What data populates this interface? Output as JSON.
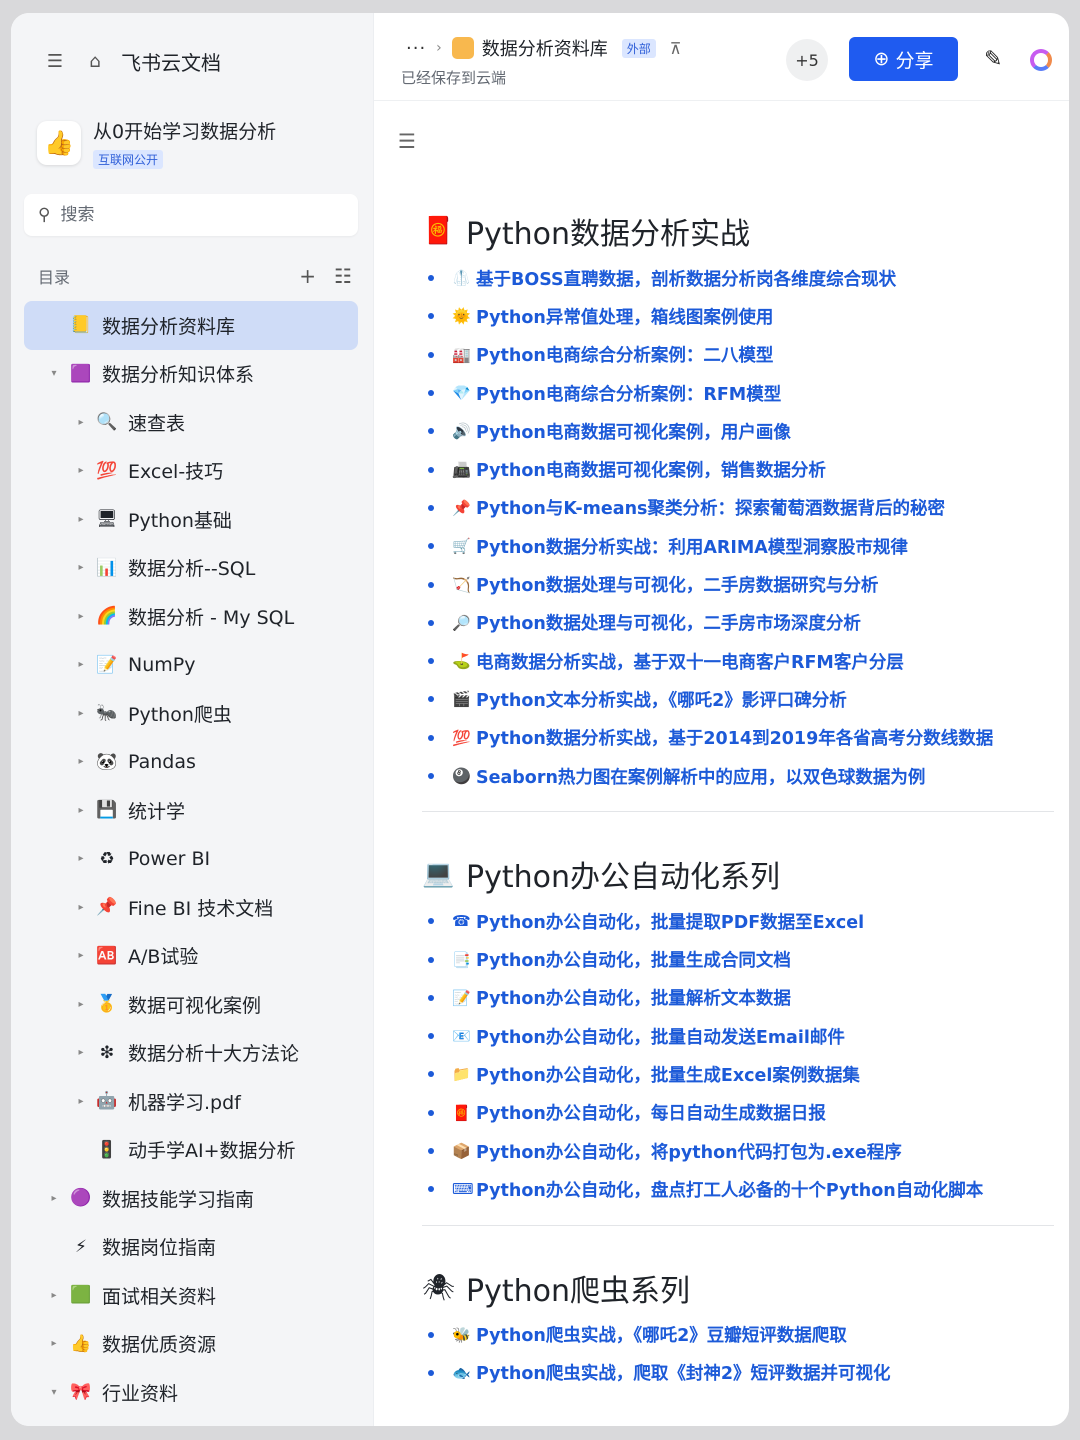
{
  "sidebar": {
    "brand": "飞书云文档",
    "workspace": {
      "title": "从0开始学习数据分析",
      "badge": "互联网公开",
      "avatar_icon": "thumbs-up-icon"
    },
    "search_placeholder": "搜索",
    "toc_label": "目录",
    "items": [
      {
        "label": "数据分析资料库",
        "level": 0,
        "arrow": "",
        "icon": "📒",
        "active": true
      },
      {
        "label": "数据分析知识体系",
        "level": 0,
        "arrow": "▾",
        "icon": "🟪"
      },
      {
        "label": "速查表",
        "level": 1,
        "arrow": "▸",
        "icon": "🔍"
      },
      {
        "label": "Excel-技巧",
        "level": 1,
        "arrow": "▸",
        "icon": "💯"
      },
      {
        "label": "Python基础",
        "level": 1,
        "arrow": "▸",
        "icon": "🖥"
      },
      {
        "label": "数据分析--SQL",
        "level": 1,
        "arrow": "▸",
        "icon": "📊"
      },
      {
        "label": "数据分析 - My SQL",
        "level": 1,
        "arrow": "▸",
        "icon": "🌈"
      },
      {
        "label": "NumPy",
        "level": 1,
        "arrow": "▸",
        "icon": "📝"
      },
      {
        "label": "Python爬虫",
        "level": 1,
        "arrow": "▸",
        "icon": "🐜"
      },
      {
        "label": "Pandas",
        "level": 1,
        "arrow": "▸",
        "icon": "🐼"
      },
      {
        "label": "统计学",
        "level": 1,
        "arrow": "▸",
        "icon": "💾"
      },
      {
        "label": "Power BI",
        "level": 1,
        "arrow": "▸",
        "icon": "♻"
      },
      {
        "label": "Fine BI 技术文档",
        "level": 1,
        "arrow": "▸",
        "icon": "📌"
      },
      {
        "label": "A/B试验",
        "level": 1,
        "arrow": "▸",
        "icon": "🆎"
      },
      {
        "label": "数据可视化案例",
        "level": 1,
        "arrow": "▸",
        "icon": "🥇"
      },
      {
        "label": "数据分析十大方法论",
        "level": 1,
        "arrow": "▸",
        "icon": "❇"
      },
      {
        "label": "机器学习.pdf",
        "level": 1,
        "arrow": "▸",
        "icon": "🤖"
      },
      {
        "label": "动手学AI+数据分析",
        "level": 1,
        "arrow": "",
        "icon": "🚦"
      },
      {
        "label": "数据技能学习指南",
        "level": 0,
        "arrow": "▸",
        "icon": "🟣"
      },
      {
        "label": "数据岗位指南",
        "level": 0,
        "arrow": "",
        "icon": "⚡"
      },
      {
        "label": "面试相关资料",
        "level": 0,
        "arrow": "▸",
        "icon": "🟩"
      },
      {
        "label": "数据优质资源",
        "level": 0,
        "arrow": "▸",
        "icon": "👍"
      },
      {
        "label": "行业资料",
        "level": 0,
        "arrow": "▾",
        "icon": "🎀"
      }
    ]
  },
  "header": {
    "breadcrumb_dots": "···",
    "doc_title": "数据分析资料库",
    "external_badge": "外部",
    "saved_status": "已经保存到云端",
    "collaborators": "+5",
    "share_label": "分享"
  },
  "sections": [
    {
      "title": "Python数据分析实战",
      "emoji": "🧧",
      "items": [
        {
          "emoji": "🥼",
          "text": "基于BOSS直聘数据，剖析数据分析岗各维度综合现状"
        },
        {
          "emoji": "🌞",
          "text": "Python异常值处理，箱线图案例使用"
        },
        {
          "emoji": "🏭",
          "text": "Python电商综合分析案例：二八模型"
        },
        {
          "emoji": "💎",
          "text": "Python电商综合分析案例：RFM模型"
        },
        {
          "emoji": "🔊",
          "text": "Python电商数据可视化案例，用户画像"
        },
        {
          "emoji": "📠",
          "text": "Python电商数据可视化案例，销售数据分析"
        },
        {
          "emoji": "📌",
          "text": "Python与K-means聚类分析：探索葡萄酒数据背后的秘密"
        },
        {
          "emoji": "🛒",
          "text": "Python数据分析实战：利用ARIMA模型洞察股市规律"
        },
        {
          "emoji": "🏹",
          "text": "Python数据处理与可视化，二手房数据研究与分析"
        },
        {
          "emoji": "🔎",
          "text": "Python数据处理与可视化，二手房市场深度分析"
        },
        {
          "emoji": "⛳",
          "text": "电商数据分析实战，基于双十一电商客户RFM客户分层"
        },
        {
          "emoji": "🎬",
          "text": "Python文本分析实战，《哪吒2》影评口碑分析"
        },
        {
          "emoji": "💯",
          "text": "Python数据分析实战，基于2014到2019年各省高考分数线数据"
        },
        {
          "emoji": "🎱",
          "text": "Seaborn热力图在案例解析中的应用，以双色球数据为例"
        }
      ]
    },
    {
      "title": "Python办公自动化系列",
      "emoji": "💻",
      "items": [
        {
          "emoji": "☎",
          "text": "Python办公自动化，批量提取PDF数据至Excel"
        },
        {
          "emoji": "📑",
          "text": "Python办公自动化，批量生成合同文档"
        },
        {
          "emoji": "📝",
          "text": "Python办公自动化，批量解析文本数据"
        },
        {
          "emoji": "📧",
          "text": "Python办公自动化，批量自动发送Email邮件"
        },
        {
          "emoji": "📁",
          "text": "Python办公自动化，批量生成Excel案例数据集"
        },
        {
          "emoji": "🧧",
          "text": "Python办公自动化，每日自动生成数据日报"
        },
        {
          "emoji": "📦",
          "text": "Python办公自动化，将python代码打包为.exe程序"
        },
        {
          "emoji": "⌨",
          "text": "Python办公自动化，盘点打工人必备的十个Python自动化脚本"
        }
      ]
    },
    {
      "title": "Python爬虫系列",
      "emoji": "🕷",
      "items": [
        {
          "emoji": "🐝",
          "text": "Python爬虫实战，《哪吒2》豆瓣短评数据爬取"
        },
        {
          "emoji": "🐟",
          "text": "Python爬虫实战，爬取《封神2》短评数据并可视化"
        }
      ]
    }
  ]
}
